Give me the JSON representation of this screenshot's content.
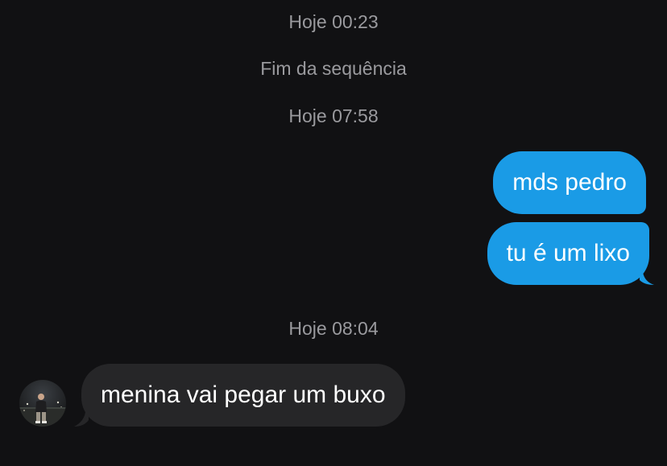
{
  "timestamps": {
    "t1": "Hoje 00:23",
    "end_of_streak": "Fim da sequência",
    "t2": "Hoje 07:58",
    "t3": "Hoje 08:04"
  },
  "messages": {
    "outgoing": [
      {
        "text": "mds pedro"
      },
      {
        "text": "tu é um lixo"
      }
    ],
    "incoming": [
      {
        "text": "menina vai pegar um buxo"
      }
    ]
  },
  "colors": {
    "background": "#111113",
    "outgoing_bubble": "#1a9be6",
    "incoming_bubble": "#262628",
    "meta_text": "#9a9a9e"
  },
  "icons": {
    "contact_avatar": "avatar-photo"
  }
}
